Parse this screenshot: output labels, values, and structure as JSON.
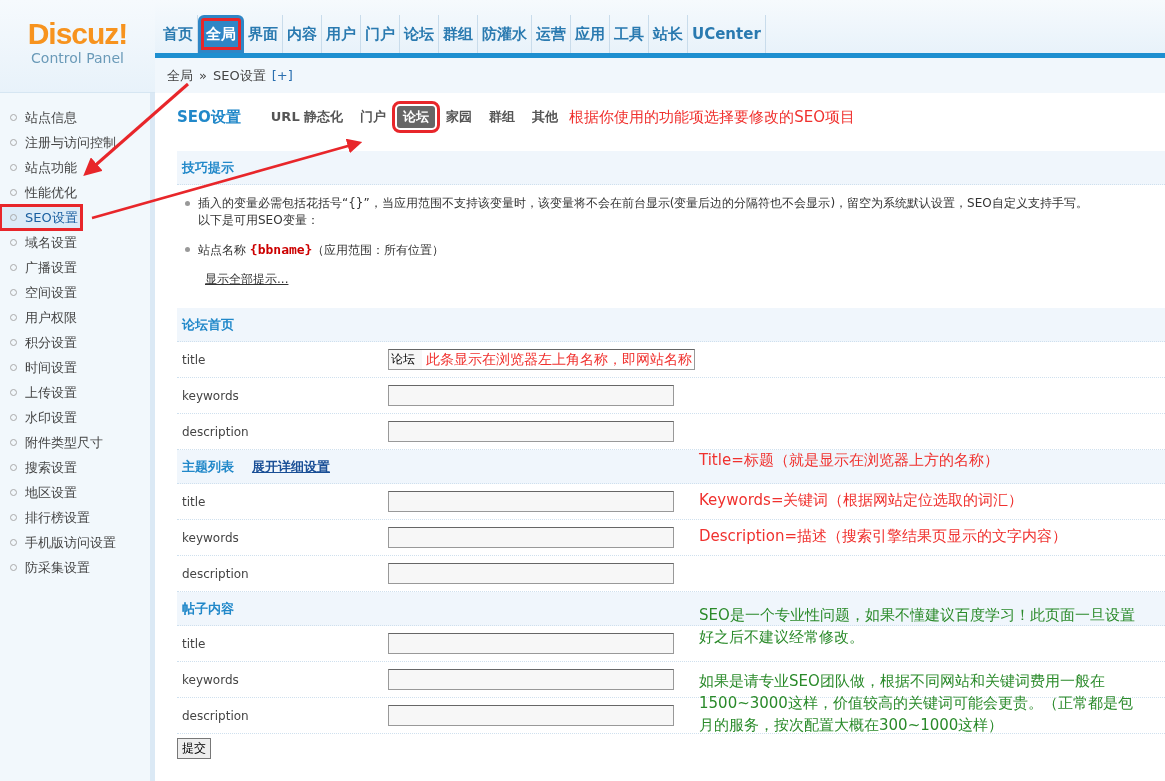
{
  "logo": {
    "name": "Discuz",
    "mark": "!",
    "subtitle": "Control Panel"
  },
  "nav": [
    {
      "label": "首页",
      "selected": false,
      "marked": false
    },
    {
      "label": "全局",
      "selected": true,
      "marked": true
    },
    {
      "label": "界面",
      "selected": false,
      "marked": false
    },
    {
      "label": "内容",
      "selected": false,
      "marked": false
    },
    {
      "label": "用户",
      "selected": false,
      "marked": false
    },
    {
      "label": "门户",
      "selected": false,
      "marked": false
    },
    {
      "label": "论坛",
      "selected": false,
      "marked": false
    },
    {
      "label": "群组",
      "selected": false,
      "marked": false
    },
    {
      "label": "防灌水",
      "selected": false,
      "marked": false
    },
    {
      "label": "运营",
      "selected": false,
      "marked": false
    },
    {
      "label": "应用",
      "selected": false,
      "marked": false
    },
    {
      "label": "工具",
      "selected": false,
      "marked": false
    },
    {
      "label": "站长",
      "selected": false,
      "marked": false
    },
    {
      "label": "UCenter",
      "selected": false,
      "marked": false
    }
  ],
  "breadcrumb": {
    "path": "全局",
    "separator": "»",
    "current": "SEO设置",
    "add": "[+]"
  },
  "sidebar": {
    "items": [
      {
        "label": "站点信息",
        "selected": false,
        "marked": false
      },
      {
        "label": "注册与访问控制",
        "selected": false,
        "marked": false
      },
      {
        "label": "站点功能",
        "selected": false,
        "marked": false
      },
      {
        "label": "性能优化",
        "selected": false,
        "marked": false
      },
      {
        "label": "SEO设置",
        "selected": true,
        "marked": true
      },
      {
        "label": "域名设置",
        "selected": false,
        "marked": false
      },
      {
        "label": "广播设置",
        "selected": false,
        "marked": false
      },
      {
        "label": "空间设置",
        "selected": false,
        "marked": false
      },
      {
        "label": "用户权限",
        "selected": false,
        "marked": false
      },
      {
        "label": "积分设置",
        "selected": false,
        "marked": false
      },
      {
        "label": "时间设置",
        "selected": false,
        "marked": false
      },
      {
        "label": "上传设置",
        "selected": false,
        "marked": false
      },
      {
        "label": "水印设置",
        "selected": false,
        "marked": false
      },
      {
        "label": "附件类型尺寸",
        "selected": false,
        "marked": false
      },
      {
        "label": "搜索设置",
        "selected": false,
        "marked": false
      },
      {
        "label": "地区设置",
        "selected": false,
        "marked": false
      },
      {
        "label": "排行榜设置",
        "selected": false,
        "marked": false
      },
      {
        "label": "手机版访问设置",
        "selected": false,
        "marked": false
      },
      {
        "label": "防采集设置",
        "selected": false,
        "marked": false
      }
    ]
  },
  "page_title": "SEO设置",
  "subtabs": [
    {
      "label": "URL 静态化",
      "selected": false,
      "marked": false
    },
    {
      "label": "门户",
      "selected": false,
      "marked": false
    },
    {
      "label": "论坛",
      "selected": true,
      "marked": true
    },
    {
      "label": "家园",
      "selected": false,
      "marked": false
    },
    {
      "label": "群组",
      "selected": false,
      "marked": false
    },
    {
      "label": "其他",
      "selected": false,
      "marked": false
    }
  ],
  "tabs_note": "根据你使用的功能项选择要修改的SEO项目",
  "tips": {
    "title": "技巧提示",
    "items": [
      {
        "lines": [
          "插入的变量必需包括花括号“{}”，当应用范围不支持该变量时，该变量将不会在前台显示(变量后边的分隔符也不会显示)，留空为系统默认设置，SEO自定义支持手写。",
          "以下是可用SEO变量："
        ]
      },
      {
        "lines": [
          "站点名称 **{bbname}**（应用范围：所有位置）"
        ]
      }
    ],
    "show_all": "显示全部提示..."
  },
  "sections": [
    {
      "title": "论坛首页",
      "fields": [
        {
          "label": "title",
          "value": "论坛",
          "note": "此条显示在浏览器左上角名称，即网站名称"
        },
        {
          "label": "keywords"
        },
        {
          "label": "description"
        }
      ]
    },
    {
      "title": "主题列表",
      "link": "展开详细设置",
      "header_note": "Title=标题（就是显示在浏览器上方的名称）",
      "fields": [
        {
          "label": "title",
          "side_note": "Keywords=关键词（根据网站定位选取的词汇）"
        },
        {
          "label": "keywords",
          "side_note": "Description=描述（搜索引擎结果页显示的文字内容）"
        },
        {
          "label": "description"
        }
      ]
    },
    {
      "title": "帖子内容",
      "fields": [
        {
          "label": "title"
        },
        {
          "label": "keywords"
        },
        {
          "label": "description"
        }
      ],
      "notes": [
        "SEO是一个专业性问题，如果不懂建议百度学习！此页面一旦设置好之后不建议经常修改。",
        "如果是请专业SEO团队做，根据不同网站和关键词费用一般在1500~3000这样，价值较高的关键词可能会更贵。（正常都是包月的服务，按次配置大概在300~1000这样）"
      ]
    }
  ],
  "submit": "提交"
}
